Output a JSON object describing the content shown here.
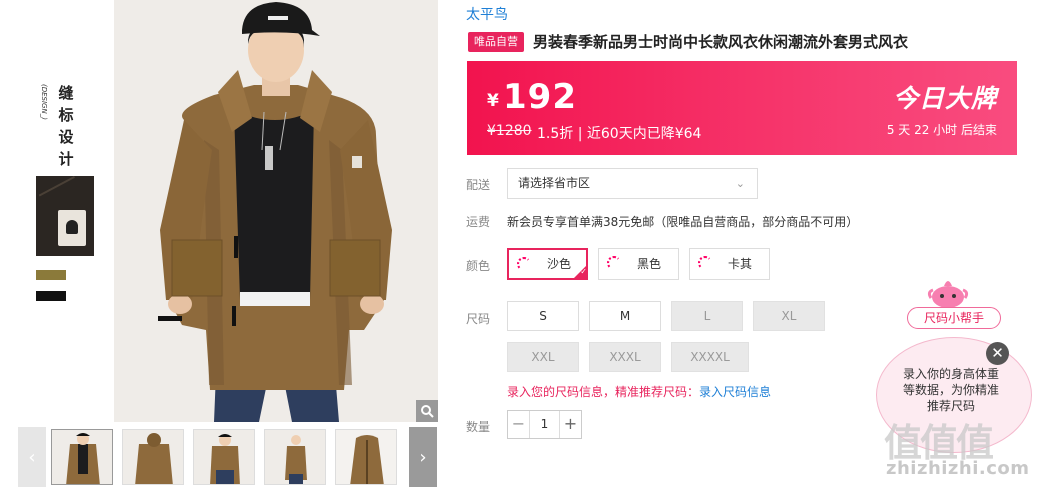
{
  "detail": {
    "vertical_title": [
      "缝",
      "标",
      "设",
      "计"
    ],
    "vertical_sub": "(DESIGN_)"
  },
  "gallery": {
    "zoom_icon": "magnifier-icon",
    "prev_icon": "‹",
    "next_icon": "›",
    "thumbnail_count": 5
  },
  "brand": "太平鸟",
  "badge": "唯品自营",
  "title": "男装春季新品男士时尚中长款风衣休闲潮流外套男式风衣",
  "price_banner": {
    "currency": "¥",
    "price": "192",
    "original_price": "¥1280",
    "meta": "1.5折 | 近60天内已降¥64",
    "today_brand": "今日大牌",
    "countdown": "5 天 22 小时 后结束"
  },
  "shipping": {
    "label": "配送",
    "select_value": "请选择省市区",
    "chevron": "⌄"
  },
  "freight": {
    "label": "运费",
    "text": "新会员专享首单满38元免邮（限唯品自营商品，部分商品不可用）"
  },
  "color": {
    "label": "颜色",
    "options": [
      {
        "name": "沙色",
        "selected": true
      },
      {
        "name": "黑色",
        "selected": false
      },
      {
        "name": "卡其",
        "selected": false
      }
    ]
  },
  "size": {
    "label": "尺码",
    "options": [
      {
        "name": "S",
        "available": true
      },
      {
        "name": "M",
        "available": true
      },
      {
        "name": "L",
        "available": false
      },
      {
        "name": "XL",
        "available": false
      },
      {
        "name": "XXL",
        "available": false
      },
      {
        "name": "XXXL",
        "available": false
      },
      {
        "name": "XXXXL",
        "available": false
      }
    ],
    "hint": "录入您的尺码信息，精准推荐尺码：",
    "hint_link": "录入尺码信息"
  },
  "quantity": {
    "label": "数量",
    "value": "1",
    "minus": "−",
    "plus": "+"
  },
  "helper": {
    "tag": "尺码小帮手",
    "text": "录入你的身高体重等数据，为你精准推荐尺码",
    "close": "✕"
  },
  "watermark": {
    "logo": "值值值",
    "url": "zhizhizhi.com"
  },
  "colors": {
    "accent": "#e8245d",
    "link": "#1e7fd6",
    "banner": "#f2134e"
  }
}
